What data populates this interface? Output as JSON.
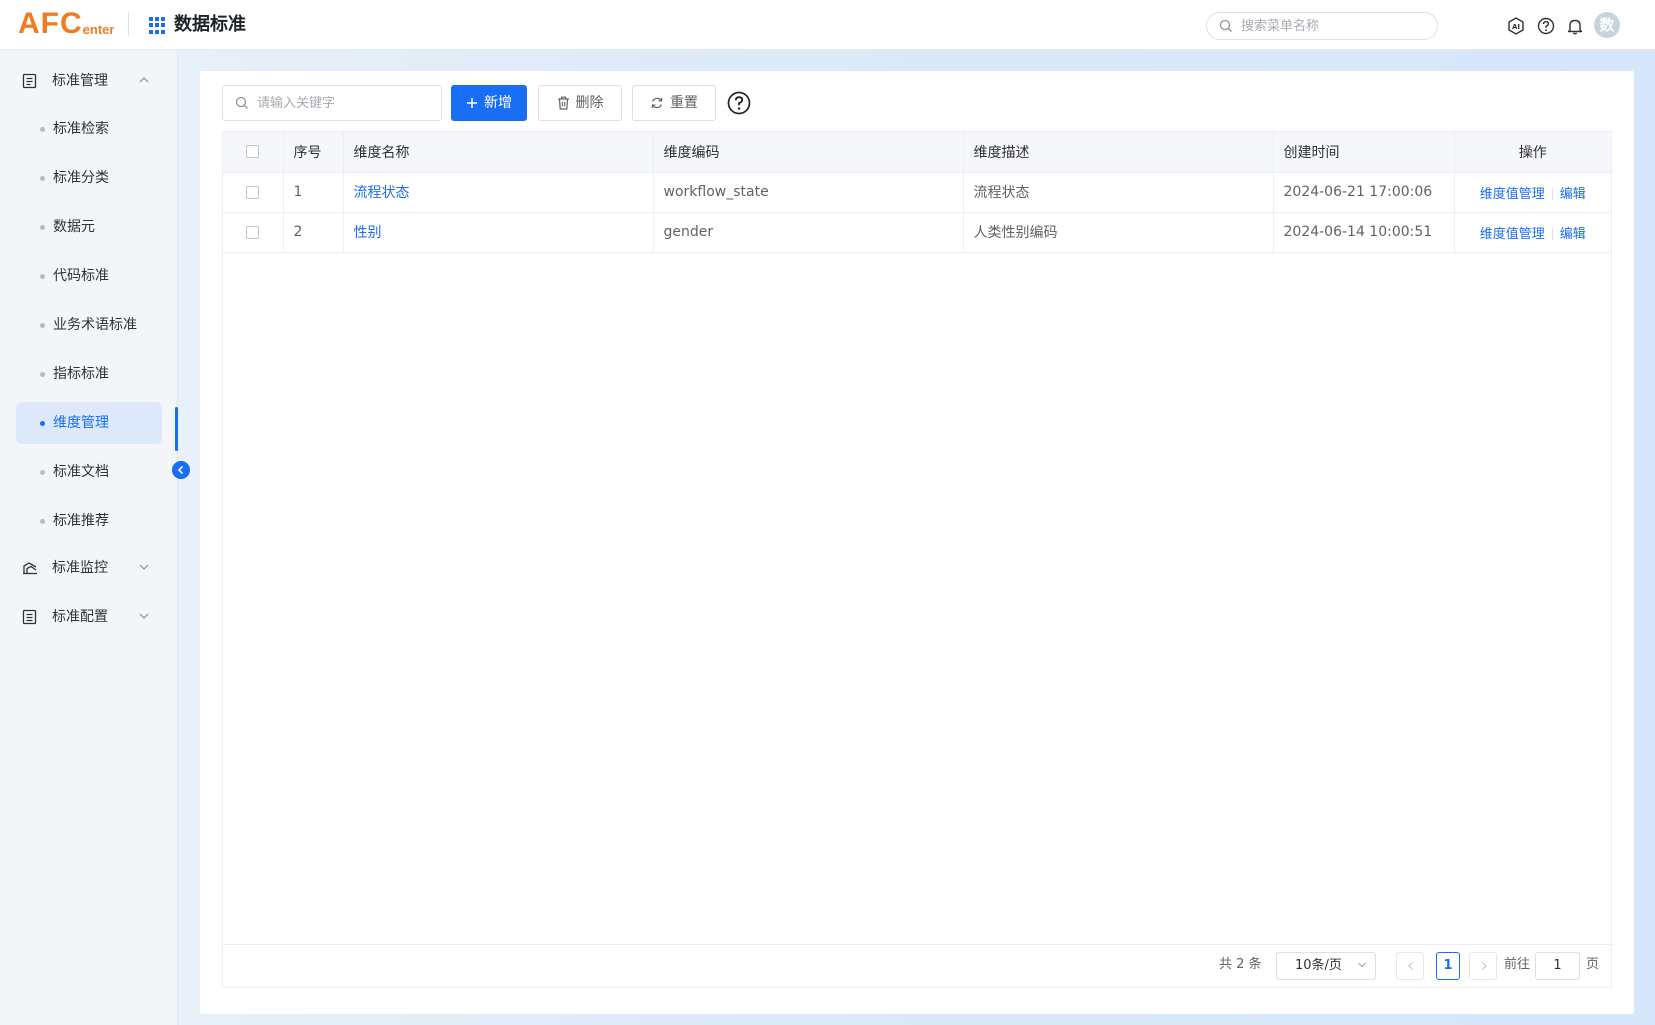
{
  "header": {
    "logo_main": "AFC",
    "logo_sub": "enter",
    "app_title": "数据标准",
    "menu_search_placeholder": "搜索菜单名称",
    "avatar_text": "数",
    "icons": [
      "ai-icon",
      "help-icon",
      "bell-icon"
    ]
  },
  "sidebar": {
    "groups": [
      {
        "label": "标准管理",
        "icon": "document-icon",
        "expanded": true
      },
      {
        "label": "标准监控",
        "icon": "monitor-icon",
        "expanded": false
      },
      {
        "label": "标准配置",
        "icon": "config-icon",
        "expanded": false
      }
    ],
    "items": [
      {
        "label": "标准检索"
      },
      {
        "label": "标准分类"
      },
      {
        "label": "数据元"
      },
      {
        "label": "代码标准"
      },
      {
        "label": "业务术语标准"
      },
      {
        "label": "指标标准"
      },
      {
        "label": "维度管理",
        "active": true
      },
      {
        "label": "标准文档"
      },
      {
        "label": "标准推荐"
      }
    ]
  },
  "toolbar": {
    "keyword_placeholder": "请输入关键字",
    "add_label": "新增",
    "delete_label": "删除",
    "reset_label": "重置"
  },
  "table": {
    "columns": [
      "序号",
      "维度名称",
      "维度编码",
      "维度描述",
      "创建时间",
      "操作"
    ],
    "rows": [
      {
        "index": "1",
        "name": "流程状态",
        "code": "workflow_state",
        "desc": "流程状态",
        "created": "2024-06-21 17:00:06",
        "op_values": "维度值管理",
        "op_edit": "编辑"
      },
      {
        "index": "2",
        "name": "性别",
        "code": "gender",
        "desc": "人类性别编码",
        "created": "2024-06-14 10:00:51",
        "op_values": "维度值管理",
        "op_edit": "编辑"
      }
    ]
  },
  "pager": {
    "total_text": "共 2 条",
    "page_size": "10条/页",
    "current_page": "1",
    "goto_prefix": "前往",
    "goto_value": "1",
    "goto_suffix": "页"
  },
  "colors": {
    "primary": "#1a6ef5",
    "logo": "#f07b21"
  }
}
